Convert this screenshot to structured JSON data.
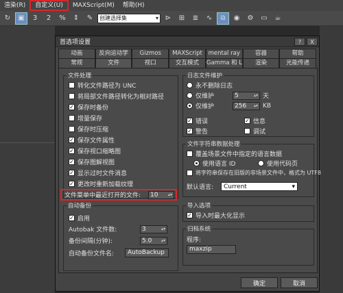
{
  "menubar": {
    "items": [
      "渲染(R)",
      "自定义(U)",
      "MAXScript(M)",
      "帮助(H)"
    ]
  },
  "toolbar": {
    "selection_set": "创建选择集",
    "buttons": [
      "rotate-icon",
      "select-region-icon",
      "snap-3-icon",
      "snap-2-icon",
      "percent-snap-icon",
      "spinner-snap-icon",
      "edit-named-sel-icon",
      "mirror-icon",
      "align-icon",
      "layer-icon",
      "curve-editor-icon",
      "schematic-icon",
      "material-editor-icon",
      "render-setup-icon",
      "render-frame-icon",
      "render-icon"
    ]
  },
  "dialog": {
    "title": "首选项设置",
    "help_btn": "?",
    "close_btn": "X",
    "tabs_row1": [
      "动画",
      "反向运动学",
      "Gizmos",
      "MAXScript",
      "mental ray",
      "容器",
      "帮助"
    ],
    "tabs_row2": [
      "常规",
      "文件",
      "视口",
      "交互模式",
      "Gamma 和 LUT",
      "渲染",
      "光能传递"
    ],
    "selected_tab": "文件",
    "file_handling": {
      "title": "文件处理",
      "options": [
        {
          "label": "转化文件路径为 UNC",
          "checked": false
        },
        {
          "label": "将局部文件路径转化为相对路径",
          "checked": false
        },
        {
          "label": "保存时备份",
          "checked": true
        },
        {
          "label": "增量保存",
          "checked": false
        },
        {
          "label": "保存时压缩",
          "checked": false
        },
        {
          "label": "保存文件属性",
          "checked": true
        },
        {
          "label": "保存视口缩略图",
          "checked": true
        },
        {
          "label": "保存图解视图",
          "checked": true
        },
        {
          "label": "显示过时文件消息",
          "checked": true
        },
        {
          "label": "更改时重新加载纹理",
          "checked": true
        }
      ],
      "recent_label": "文件菜单中最近打开的文件:",
      "recent_value": "10"
    },
    "auto_backup": {
      "title": "自动备份",
      "enable_label": "启用",
      "enabled": true,
      "count_label": "Autobak 文件数:",
      "count_value": "3",
      "interval_label": "备份间隔(分钟):",
      "interval_value": "5.0",
      "name_label": "自动备份文件名:",
      "name_value": "AutoBackup"
    },
    "log_maintenance": {
      "title": "日志文件维护",
      "never_delete": "永不删除日志",
      "keep1_label": "仅维护",
      "keep1_value": "5",
      "keep1_unit": "天",
      "keep2_label": "仅维护",
      "keep2_value": "256",
      "keep2_unit": "KB",
      "errors": "错误",
      "info": "信息",
      "warnings": "警告",
      "debug": "调试"
    },
    "string_handling": {
      "title": "文件字符串数据处理",
      "override": "覆盖场景文件中指定的语言数据",
      "use_lang_id": "使用语言 ID",
      "use_codepage": "使用代码页",
      "utf8": "将字符串保存在旧版的非场景文件中，格式为 UTF8",
      "default_lang_label": "默认语言:",
      "default_lang_value": "Current"
    },
    "import": {
      "title": "导入选项",
      "maximize": "导入时最大化显示"
    },
    "archive": {
      "title": "归档系统",
      "program_label": "程序:",
      "program_value": "maxzip"
    },
    "ok": "确定",
    "cancel": "取消"
  },
  "colors": {
    "highlight": "#d9262a",
    "toolbar_active": "#6a8ec0"
  }
}
